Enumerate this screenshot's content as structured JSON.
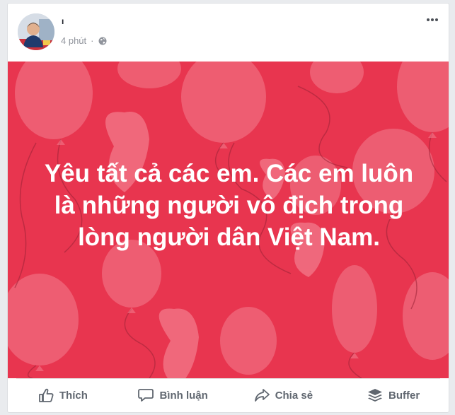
{
  "post": {
    "author_name": "ı",
    "timestamp": "4 phút",
    "separator": "·",
    "privacy_icon": "globe-icon",
    "more_icon": "more-options-icon",
    "text": "Yêu tất cả các em. Các em luôn là những người vô địch trong lòng người dân Việt Nam.",
    "background_color": "#e8354f"
  },
  "actions": {
    "like_label": "Thích",
    "comment_label": "Bình luận",
    "share_label": "Chia sẻ",
    "buffer_label": "Buffer"
  }
}
